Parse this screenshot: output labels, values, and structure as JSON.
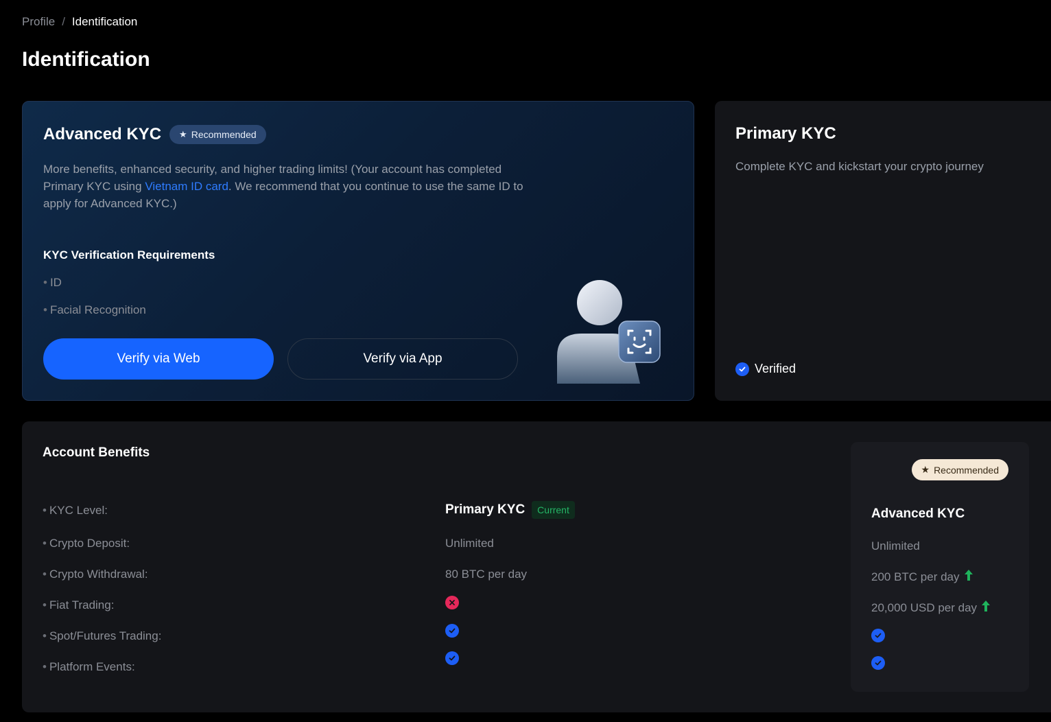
{
  "breadcrumb": {
    "parent": "Profile",
    "separator": "/",
    "current": "Identification"
  },
  "page_title": "Identification",
  "advanced": {
    "title": "Advanced KYC",
    "badge": "Recommended",
    "desc_pre": "More benefits, enhanced security, and higher trading limits!  (Your account has completed Primary KYC using ",
    "desc_link": "Vietnam ID card",
    "desc_post": ". We recommend that you continue to use the same ID to apply for Advanced KYC.)",
    "requirements_title": "KYC Verification Requirements",
    "requirements": [
      "ID",
      "Facial Recognition"
    ],
    "btn_web": "Verify via Web",
    "btn_app": "Verify via App"
  },
  "primary": {
    "title": "Primary KYC",
    "desc": "Complete KYC and kickstart your crypto journey",
    "status": "Verified"
  },
  "benefits": {
    "title": "Account Benefits",
    "labels": [
      "KYC Level:",
      "Crypto Deposit:",
      "Crypto Withdrawal:",
      "Fiat Trading:",
      "Spot/Futures Trading:",
      "Platform Events:"
    ],
    "current": {
      "level": "Primary KYC",
      "badge": "Current",
      "deposit": "Unlimited",
      "withdrawal": "80 BTC per day",
      "fiat": "not-available",
      "spot": "available",
      "events": "available"
    },
    "advanced_panel": {
      "badge": "Recommended",
      "title": "Advanced KYC",
      "deposit": "Unlimited",
      "withdrawal": "200 BTC per day",
      "fiat": "20,000 USD per day",
      "spot": "available",
      "events": "available"
    }
  },
  "colors": {
    "accent": "#1664ff",
    "link": "#2f7cff",
    "success": "#25b566",
    "error": "#e5285a",
    "check": "#1d5ef5"
  }
}
